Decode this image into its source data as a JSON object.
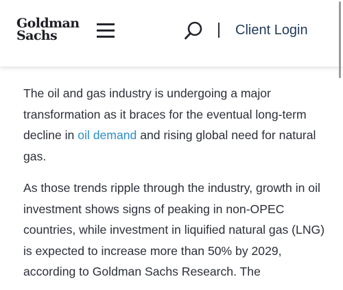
{
  "header": {
    "logo_line1": "Goldman",
    "logo_line2": "Sachs",
    "menu_icon": "hamburger-menu-icon",
    "search_icon": "search-icon",
    "client_login_label": "Client Login"
  },
  "article": {
    "p1_before": "The oil and gas industry is undergoing a major transformation as it braces for the eventual long-term decline in ",
    "p1_link": "oil demand",
    "p1_after": " and rising global need for natural gas.",
    "p2": "As those trends ripple through the industry, growth in oil investment shows signs of peaking in non-OPEC countries, while investment in liquified natural gas (LNG) is expected to increase more than 50% by 2029, according to Goldman Sachs Research. The"
  },
  "colors": {
    "link": "#2a8ec9",
    "login": "#1f3a59",
    "text": "#2b2f38"
  }
}
